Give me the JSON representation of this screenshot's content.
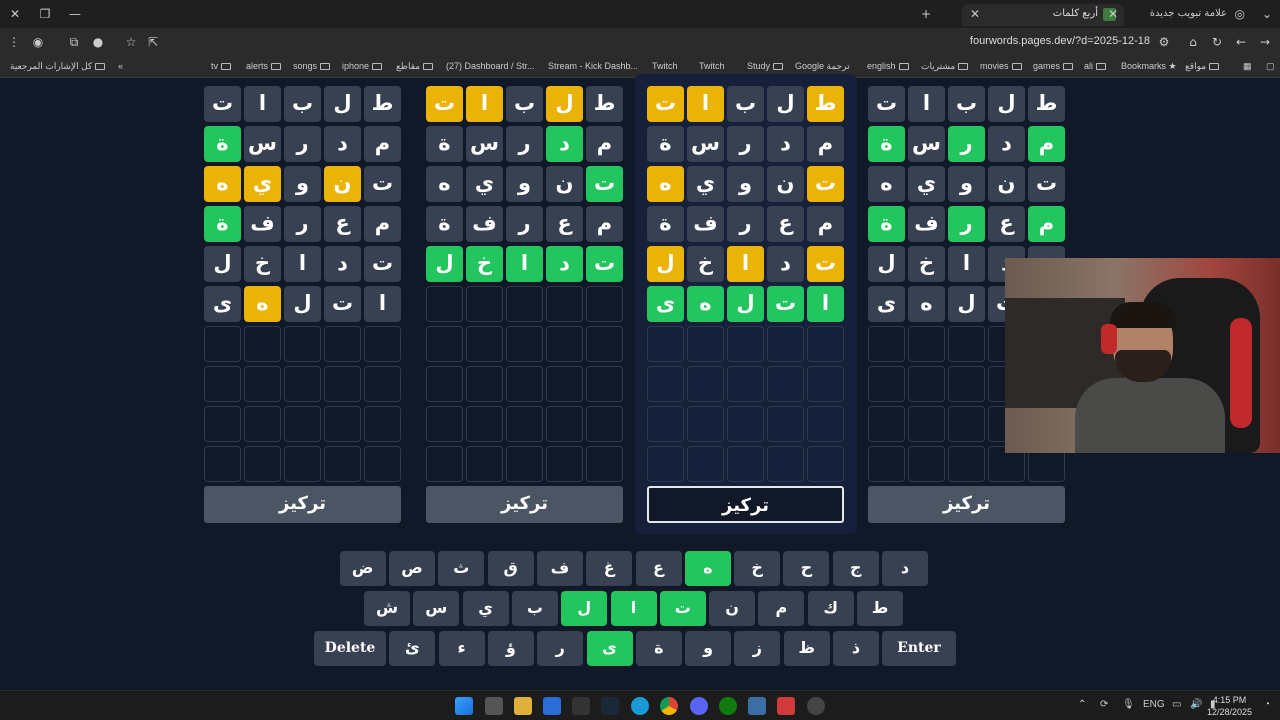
{
  "browser": {
    "tabs": [
      {
        "label": "أربع كلمات",
        "active": true
      },
      {
        "label": "علامة تبويب جديدة",
        "active": false
      }
    ],
    "url": "fourwords.pages.dev/?d=2025-12-18",
    "bookmarks": [
      "مواقع",
      "Bookmarks",
      "ali",
      "games",
      "movies",
      "مشتريات",
      "english",
      "Google ترجمة",
      "Study",
      "Twitch",
      "Twitch",
      "Stream - Kick Dashb...",
      "(27) Dashboard / Str...",
      "مقاطع",
      "iphone",
      "songs",
      "alerts",
      "tv"
    ],
    "all_bookmarks": "كل الإشارات المرجعية"
  },
  "boards": [
    {
      "rows": [
        {
          "letters": [
            "ط",
            "ل",
            "ب",
            "ا",
            "ت"
          ],
          "states": [
            "grey",
            "grey",
            "grey",
            "grey",
            "grey"
          ]
        },
        {
          "letters": [
            "م",
            "د",
            "ر",
            "س",
            "ة"
          ],
          "states": [
            "green",
            "grey",
            "green",
            "grey",
            "green"
          ]
        },
        {
          "letters": [
            "ت",
            "ن",
            "و",
            "ي",
            "ه"
          ],
          "states": [
            "grey",
            "grey",
            "grey",
            "grey",
            "grey"
          ]
        },
        {
          "letters": [
            "م",
            "ع",
            "ر",
            "ف",
            "ة"
          ],
          "states": [
            "green",
            "grey",
            "green",
            "grey",
            "green"
          ]
        },
        {
          "letters": [
            "ت",
            "د",
            "ا",
            "خ",
            "ل"
          ],
          "states": [
            "grey",
            "grey",
            "grey",
            "grey",
            "grey"
          ]
        },
        {
          "letters": [
            "ا",
            "ت",
            "ل",
            "ه",
            "ى"
          ],
          "states": [
            "grey",
            "grey",
            "grey",
            "grey",
            "grey"
          ]
        }
      ],
      "focus_label": "تركيز",
      "focused": false
    },
    {
      "rows": [
        {
          "letters": [
            "ط",
            "ل",
            "ب",
            "ا",
            "ت"
          ],
          "states": [
            "yellow",
            "grey",
            "grey",
            "yellow",
            "yellow"
          ]
        },
        {
          "letters": [
            "م",
            "د",
            "ر",
            "س",
            "ة"
          ],
          "states": [
            "grey",
            "grey",
            "grey",
            "grey",
            "grey"
          ]
        },
        {
          "letters": [
            "ت",
            "ن",
            "و",
            "ي",
            "ه"
          ],
          "states": [
            "yellow",
            "grey",
            "grey",
            "grey",
            "yellow"
          ]
        },
        {
          "letters": [
            "م",
            "ع",
            "ر",
            "ف",
            "ة"
          ],
          "states": [
            "grey",
            "grey",
            "grey",
            "grey",
            "grey"
          ]
        },
        {
          "letters": [
            "ت",
            "د",
            "ا",
            "خ",
            "ل"
          ],
          "states": [
            "yellow",
            "grey",
            "yellow",
            "grey",
            "yellow"
          ]
        },
        {
          "letters": [
            "ا",
            "ت",
            "ل",
            "ه",
            "ى"
          ],
          "states": [
            "green",
            "green",
            "green",
            "green",
            "green"
          ]
        }
      ],
      "focus_label": "تركيز",
      "focused": true
    },
    {
      "rows": [
        {
          "letters": [
            "ط",
            "ل",
            "ب",
            "ا",
            "ت"
          ],
          "states": [
            "grey",
            "yellow",
            "grey",
            "yellow",
            "yellow"
          ]
        },
        {
          "letters": [
            "م",
            "د",
            "ر",
            "س",
            "ة"
          ],
          "states": [
            "grey",
            "green",
            "grey",
            "grey",
            "grey"
          ]
        },
        {
          "letters": [
            "ت",
            "ن",
            "و",
            "ي",
            "ه"
          ],
          "states": [
            "green",
            "grey",
            "grey",
            "grey",
            "grey"
          ]
        },
        {
          "letters": [
            "م",
            "ع",
            "ر",
            "ف",
            "ة"
          ],
          "states": [
            "grey",
            "grey",
            "grey",
            "grey",
            "grey"
          ]
        },
        {
          "letters": [
            "ت",
            "د",
            "ا",
            "خ",
            "ل"
          ],
          "states": [
            "green",
            "green",
            "green",
            "green",
            "green"
          ]
        },
        {
          "letters": [
            "",
            "",
            "",
            "",
            ""
          ],
          "states": [
            "empty",
            "empty",
            "empty",
            "empty",
            "empty"
          ]
        }
      ],
      "focus_label": "تركيز",
      "focused": false
    },
    {
      "rows": [
        {
          "letters": [
            "ط",
            "ل",
            "ب",
            "ا",
            "ت"
          ],
          "states": [
            "grey",
            "grey",
            "grey",
            "grey",
            "grey"
          ]
        },
        {
          "letters": [
            "م",
            "د",
            "ر",
            "س",
            "ة"
          ],
          "states": [
            "grey",
            "grey",
            "grey",
            "grey",
            "green"
          ]
        },
        {
          "letters": [
            "ت",
            "ن",
            "و",
            "ي",
            "ه"
          ],
          "states": [
            "grey",
            "yellow",
            "grey",
            "yellow",
            "yellow"
          ]
        },
        {
          "letters": [
            "م",
            "ع",
            "ر",
            "ف",
            "ة"
          ],
          "states": [
            "grey",
            "grey",
            "grey",
            "grey",
            "green"
          ]
        },
        {
          "letters": [
            "ت",
            "د",
            "ا",
            "خ",
            "ل"
          ],
          "states": [
            "grey",
            "grey",
            "grey",
            "grey",
            "grey"
          ]
        },
        {
          "letters": [
            "ا",
            "ت",
            "ل",
            "ه",
            "ى"
          ],
          "states": [
            "grey",
            "grey",
            "grey",
            "yellow",
            "grey"
          ]
        }
      ],
      "focus_label": "تركيز",
      "focused": false
    }
  ],
  "keyboard": {
    "row1": [
      {
        "k": "د",
        "s": "grey"
      },
      {
        "k": "ج",
        "s": "grey"
      },
      {
        "k": "ح",
        "s": "grey"
      },
      {
        "k": "خ",
        "s": "grey"
      },
      {
        "k": "ه",
        "s": "green"
      },
      {
        "k": "ع",
        "s": "grey"
      },
      {
        "k": "غ",
        "s": "grey"
      },
      {
        "k": "ف",
        "s": "grey"
      },
      {
        "k": "ق",
        "s": "grey"
      },
      {
        "k": "ث",
        "s": "grey"
      },
      {
        "k": "ص",
        "s": "grey"
      },
      {
        "k": "ض",
        "s": "grey"
      }
    ],
    "row2": [
      {
        "k": "ط",
        "s": "grey"
      },
      {
        "k": "ك",
        "s": "grey"
      },
      {
        "k": "م",
        "s": "grey"
      },
      {
        "k": "ن",
        "s": "grey"
      },
      {
        "k": "ت",
        "s": "green"
      },
      {
        "k": "ا",
        "s": "green"
      },
      {
        "k": "ل",
        "s": "green"
      },
      {
        "k": "ب",
        "s": "grey"
      },
      {
        "k": "ي",
        "s": "grey"
      },
      {
        "k": "س",
        "s": "grey"
      },
      {
        "k": "ش",
        "s": "grey"
      }
    ],
    "row3": [
      {
        "k": "Enter",
        "s": "grey"
      },
      {
        "k": "ذ",
        "s": "grey"
      },
      {
        "k": "ظ",
        "s": "grey"
      },
      {
        "k": "ز",
        "s": "grey"
      },
      {
        "k": "و",
        "s": "grey"
      },
      {
        "k": "ة",
        "s": "grey"
      },
      {
        "k": "ى",
        "s": "green"
      },
      {
        "k": "ر",
        "s": "grey"
      },
      {
        "k": "ؤ",
        "s": "grey"
      },
      {
        "k": "ء",
        "s": "grey"
      },
      {
        "k": "ئ",
        "s": "grey"
      },
      {
        "k": "Delete",
        "s": "grey"
      }
    ]
  },
  "taskbar": {
    "lang": "ENG",
    "time": "4:15 PM",
    "date": "12/28/2025"
  },
  "colors": {
    "green": "#22c55e",
    "yellow": "#eab308",
    "grey": "#374151",
    "background": "#111827"
  }
}
